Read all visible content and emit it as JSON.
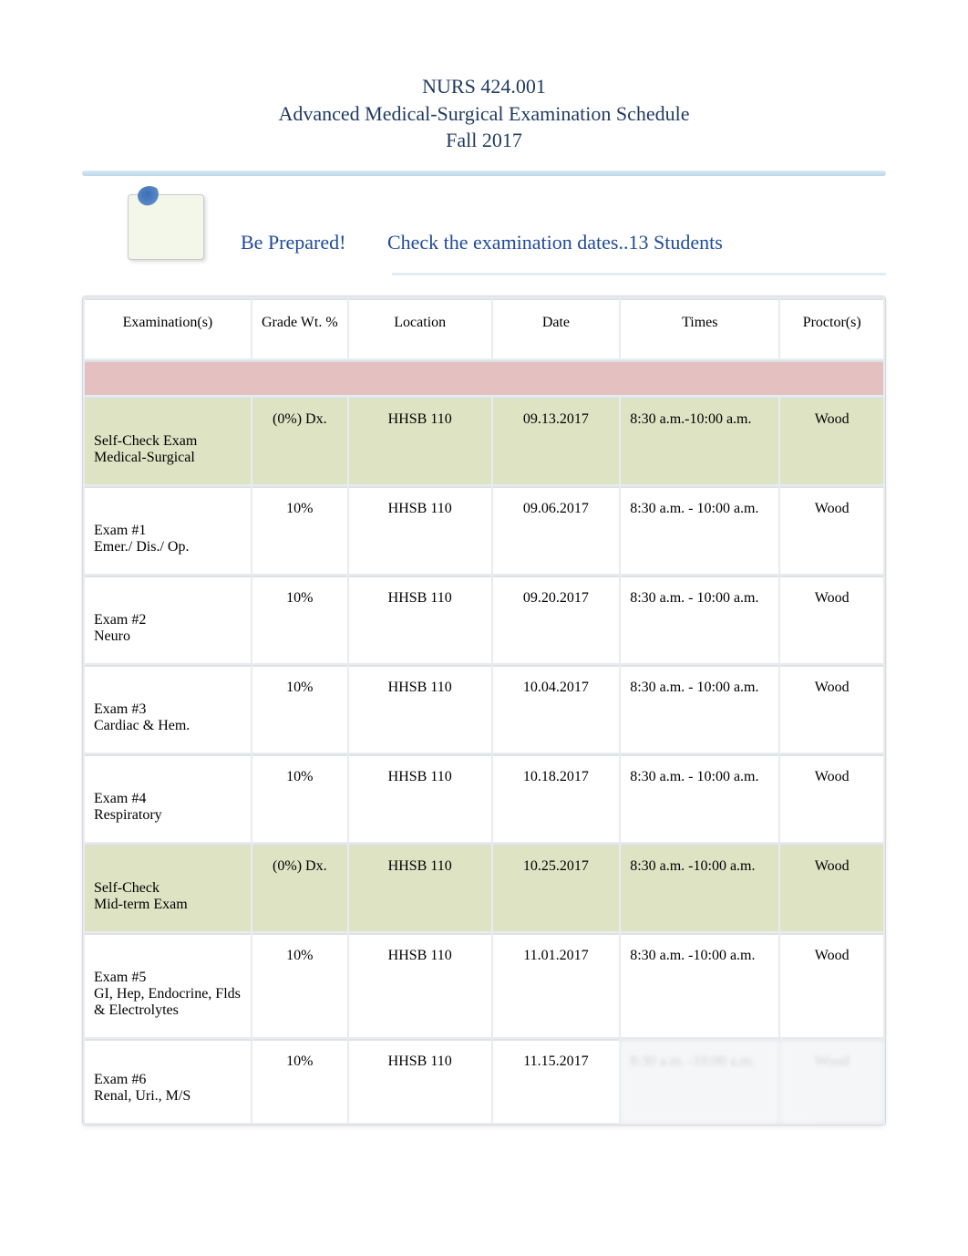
{
  "header": {
    "course": "NURS 424.001",
    "title": "Advanced Medical-Surgical Examination Schedule",
    "term": "Fall 2017"
  },
  "banner": {
    "prep": "Be Prepared!",
    "check": "Check the examination dates..13 Students"
  },
  "columns": {
    "exam": "Examination(s)",
    "grade": "Grade Wt. %",
    "location": "Location",
    "date": "Date",
    "times": "Times",
    "proctor": "Proctor(s)"
  },
  "rows": [
    {
      "type": "green",
      "exam": "Self-Check Exam",
      "sub": "Medical-Surgical",
      "grade": "(0%) Dx.",
      "location": "HHSB 110",
      "date": "09.13.2017",
      "times": "8:30 a.m.-10:00 a.m.",
      "proctor": "Wood"
    },
    {
      "type": "normal",
      "exam": " Exam #1",
      "sub": "Emer./ Dis./ Op.",
      "grade": "10%",
      "location": "HHSB 110",
      "date": "09.06.2017",
      "times": "8:30 a.m. - 10:00 a.m.",
      "proctor": "Wood"
    },
    {
      "type": "normal",
      "exam": "Exam #2",
      "sub": "Neuro",
      "grade": "10%",
      "location": "HHSB 110",
      "date": "09.20.2017",
      "times": "8:30 a.m. - 10:00 a.m.",
      "proctor": "Wood"
    },
    {
      "type": "normal",
      "exam": "Exam #3",
      "sub": "Cardiac & Hem.",
      "grade": "10%",
      "location": "HHSB 110",
      "date": "10.04.2017",
      "times": "8:30 a.m. - 10:00 a.m.",
      "proctor": "Wood"
    },
    {
      "type": "normal",
      "exam": "Exam #4",
      "sub": "Respiratory",
      "grade": "10%",
      "location": "HHSB 110",
      "date": "10.18.2017",
      "times": "8:30 a.m. - 10:00 a.m.",
      "proctor": "Wood"
    },
    {
      "type": "green",
      "exam": "Self-Check",
      "sub": "Mid-term Exam",
      "grade": "(0%) Dx.",
      "location": "HHSB 110",
      "date": "10.25.2017",
      "times": "8:30 a.m. -10:00 a.m.",
      "proctor": "Wood"
    },
    {
      "type": "normal",
      "exam": "Exam #5",
      "sub": "GI, Hep, Endocrine, Flds & Electrolytes",
      "grade": "10%",
      "location": "HHSB 110",
      "date": "11.01.2017",
      "times": "8:30 a.m. -10:00 a.m.",
      "proctor": "Wood"
    },
    {
      "type": "cutoff",
      "exam": "Exam #6",
      "sub": "Renal, Uri., M/S",
      "grade": "10%",
      "location": "HHSB 110",
      "date": "11.15.2017",
      "times": "8:30 a.m. -10:00 a.m.",
      "proctor": "Wood"
    }
  ]
}
